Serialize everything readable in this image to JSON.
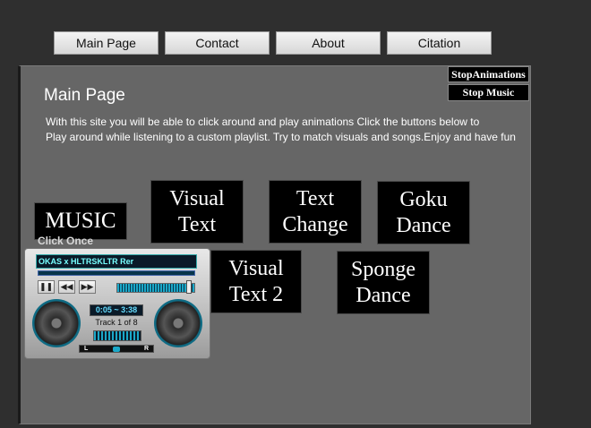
{
  "nav": {
    "main_page": "Main Page",
    "contact": "Contact",
    "about": "About",
    "citation": "Citation"
  },
  "controls": {
    "stop_animations": "StopAnimations",
    "stop_music": "Stop Music"
  },
  "main": {
    "title": "Main Page",
    "intro_line1": "With this site you will be able to click around and play animations Click the buttons below to",
    "intro_line2": "Play around while listening to a custom playlist. Try to match visuals and songs.Enjoy and have fun"
  },
  "buttons": {
    "music": "MUSIC",
    "click_once": "Click Once",
    "visual_text_1": "Visual",
    "visual_text_2": "Text",
    "text_change_1": "Text",
    "text_change_2": "Change",
    "goku_dance_1": "Goku",
    "goku_dance_2": "Dance",
    "visual_text2_1": "Visual",
    "visual_text2_2": "Text 2",
    "sponge_dance_1": "Sponge",
    "sponge_dance_2": "Dance"
  },
  "player": {
    "now_playing": "OKAS x HLTRSKLTR Rer",
    "time": "0:05 ~ 3:38",
    "track": "Track 1 of 8",
    "balance_left": "L",
    "balance_right": "R",
    "volume_level": 0.95,
    "accent_color": "#1ba8c8"
  }
}
